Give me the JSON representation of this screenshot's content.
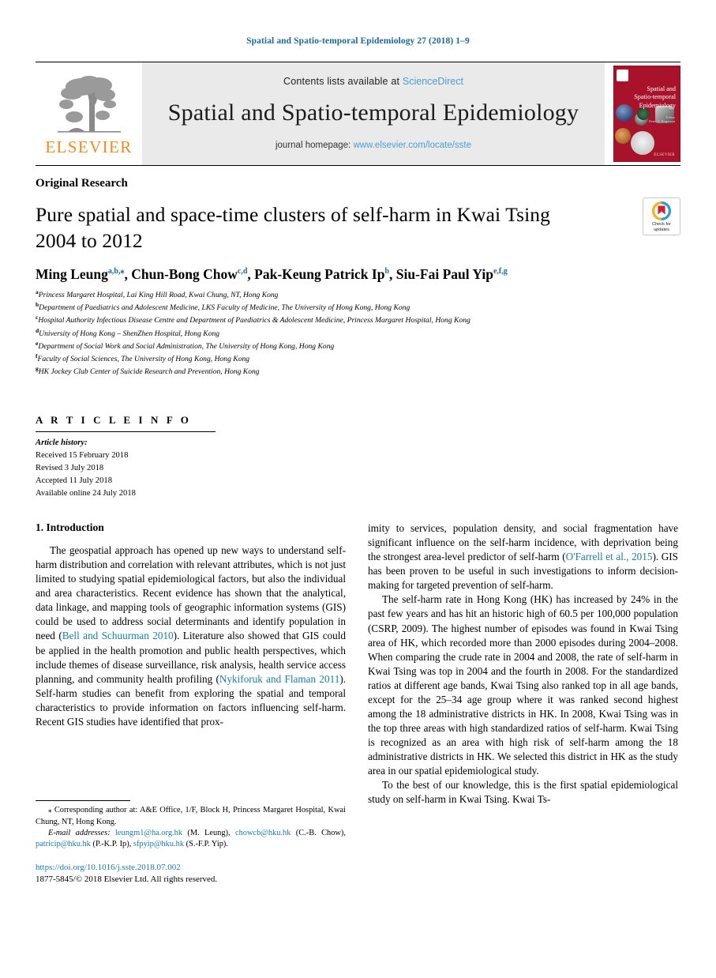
{
  "running_head": "Spatial and Spatio-temporal Epidemiology 27 (2018) 1–9",
  "masthead": {
    "publisher_name": "ELSEVIER",
    "contents_prefix": "Contents lists available at",
    "sciencedirect_label": "ScienceDirect",
    "journal_title": "Spatial and Spatio-temporal Epidemiology",
    "homepage_prefix": "journal homepage:",
    "homepage_url": "www.elsevier.com/locate/sste",
    "cover": {
      "title_line1": "Spatial and",
      "title_line2": "Spatio-temporal",
      "title_line3": "Epidemiology",
      "editor_label": "Editor",
      "editor_name": "Peter A. Rogerson",
      "publisher_mark": "ELSEVIER",
      "background_color": "#a8122a"
    }
  },
  "article": {
    "kicker": "Original Research",
    "title": "Pure spatial and space-time clusters of self-harm in Kwai Tsing 2004 to 2012",
    "authors": [
      {
        "name": "Ming Leung",
        "sup": "a,b,⁎"
      },
      {
        "name": "Chun-Bong Chow",
        "sup": "c,d"
      },
      {
        "name": "Pak-Keung Patrick Ip",
        "sup": "b"
      },
      {
        "name": "Siu-Fai Paul Yip",
        "sup": "e,f,g"
      }
    ],
    "affiliations": [
      {
        "mark": "a",
        "text": "Princess Margaret Hospital, Lai King Hill Road, Kwai Chung, NT, Hong Kong"
      },
      {
        "mark": "b",
        "text": "Department of Paediatrics and Adolescent Medicine, LKS Faculty of Medicine, The University of Hong Kong, Hong Kong"
      },
      {
        "mark": "c",
        "text": "Hospital Authority Infectious Disease Centre and Department of Paediatrics & Adolescent Medicine, Princess Margaret Hospital, Hong Kong"
      },
      {
        "mark": "d",
        "text": "University of Hong Kong – ShenZhen Hospital, Hong Kong"
      },
      {
        "mark": "e",
        "text": "Department of Social Work and Social Administration, The University of Hong Kong, Hong Kong"
      },
      {
        "mark": "f",
        "text": "Faculty of Social Sciences, The University of Hong Kong, Hong Kong"
      },
      {
        "mark": "g",
        "text": "HK Jockey Club Center of Suicide Research and Prevention, Hong Kong"
      }
    ],
    "crossmark": {
      "line1": "Check for",
      "line2": "updates"
    }
  },
  "article_info": {
    "heading": "A R T I C L E   I N F O",
    "history_label": "Article history:",
    "history": [
      "Received 15 February 2018",
      "Revised 3 July 2018",
      "Accepted 11 July 2018",
      "Available online 24 July 2018"
    ]
  },
  "body": {
    "section_number_title": "1. Introduction",
    "left_paragraph_1_a": "The geospatial approach has opened up new ways to understand self-harm distribution and correlation with relevant attributes, which is not just limited to studying spatial epidemiological factors, but also the individual and area characteristics. Recent evidence has shown that the analytical, data linkage, and mapping tools of geographic information systems (GIS) could be used to address social determinants and identify population in need (",
    "cite_bell": "Bell and Schuurman 2010",
    "left_paragraph_1_b": "). Literature also showed that GIS could be applied in the health promotion and public health perspectives, which include themes of disease surveillance, risk analysis, health service access planning, and community health profiling (",
    "cite_nykiforuk": "Nykiforuk and Flaman 2011",
    "left_paragraph_1_c": "). Self-harm studies can benefit from exploring the spatial and temporal characteristics to provide information on factors influencing self-harm. Recent GIS studies have identified that prox-",
    "right_paragraph_1_a": "imity to services, population density, and social fragmentation have significant influence on the self-harm incidence, with deprivation being the strongest area-level predictor of self-harm (",
    "cite_ofarrell": "O'Farrell et al., 2015",
    "right_paragraph_1_b": "). GIS has been proven to be useful in such investigations to inform decision-making for targeted prevention of self-harm.",
    "right_paragraph_2": "The self-harm rate in Hong Kong (HK) has increased by 24% in the past few years and has hit an historic high of 60.5 per 100,000 population (CSRP, 2009). The highest number of episodes was found in Kwai Tsing area of HK, which recorded more than 2000 episodes during 2004–2008. When comparing the crude rate in 2004 and 2008, the rate of self-harm in Kwai Tsing was top in 2004 and the fourth in 2008. For the standardized ratios at different age bands, Kwai Tsing also ranked top in all age bands, except for the 25–34 age group where it was ranked second highest among the 18 administrative districts in HK. In 2008, Kwai Tsing was in the top three areas with high standardized ratios of self-harm. Kwai Tsing is recognized as an area with high risk of self-harm among the 18 administrative districts in HK. We selected this district in HK as the study area in our spatial epidemiological study.",
    "right_paragraph_3": "To the best of our knowledge, this is the first spatial epidemiological study on self-harm in Kwai Tsing. Kwai Ts-"
  },
  "footnotes": {
    "star": "⁎",
    "corresponding": "Corresponding author at: A&E Office, 1/F, Block H, Princess Margaret Hospital, Kwai Chung, NT, Hong Kong.",
    "email_label": "E-mail addresses:",
    "emails": [
      {
        "address": "leungm1@ha.org.hk",
        "owner": "(M. Leung),"
      },
      {
        "address": "chowcb@hku.hk",
        "owner": "(C.-B. Chow),"
      },
      {
        "address": "patricip@hku.hk",
        "owner": "(P.-K.P. Ip),"
      },
      {
        "address": "sfpyip@hku.hk",
        "owner": "(S.-F.P. Yip)."
      }
    ],
    "doi": "https://doi.org/10.1016/j.sste.2018.07.002",
    "copyright": "1877-5845/© 2018 Elsevier Ltd. All rights reserved."
  },
  "colors": {
    "link_blue": "#1b7ba6",
    "sciencedirect_blue": "#4b9dd4",
    "elsevier_orange": "#f08a1d",
    "cover_red": "#a8122a"
  }
}
